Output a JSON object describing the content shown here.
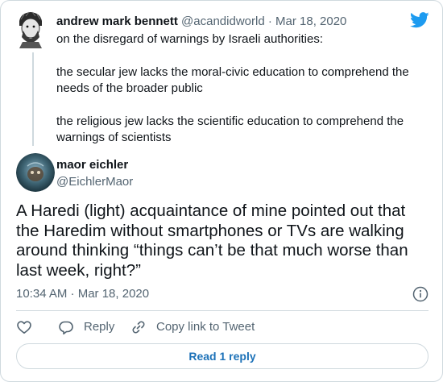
{
  "parent_tweet": {
    "display_name": "andrew mark bennett",
    "handle": "@acandidworld",
    "separator": "·",
    "date": "Mar 18, 2020",
    "paragraphs": [
      "on the disregard of warnings by Israeli authorities:",
      "the secular jew lacks the moral-civic education to comprehend the needs of the broader public",
      "the religious jew lacks the scientific education to comprehend the warnings of scientists"
    ]
  },
  "main_tweet": {
    "display_name": "maor eichler",
    "handle": "@EichlerMaor",
    "text": "A Haredi (light) acquaintance of mine pointed out that the Haredim without smartphones or TVs are walking around thinking “things can’t be that much worse than last week, right?”",
    "timestamp": "10:34 AM · Mar 18, 2020"
  },
  "actions": {
    "reply_label": "Reply",
    "copy_link_label": "Copy link to Tweet"
  },
  "read_replies_label": "Read 1 reply",
  "icons": [
    "twitter-bird-icon",
    "info-icon",
    "heart-icon",
    "reply-icon",
    "link-icon"
  ],
  "colors": {
    "twitter_blue": "#1d9bf0",
    "link_blue": "#1d72b8",
    "muted_text": "#536471",
    "border": "#cfd9de",
    "like_red": "#e0245e"
  }
}
